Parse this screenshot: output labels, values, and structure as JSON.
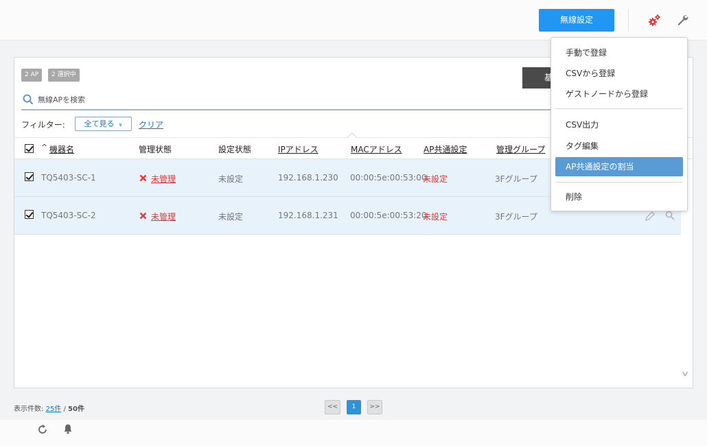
{
  "header": {
    "wireless_settings_button": "無線設定",
    "icons": [
      "gears-icon",
      "wrench-icon"
    ]
  },
  "panel": {
    "badge_ap": "2 AP",
    "badge_selected": "2 選択中",
    "dark_button_partial": "基",
    "search": {
      "placeholder": "無線APを検索",
      "value": ""
    },
    "filter": {
      "label": "フィルター:",
      "selected": "全て見る",
      "clear": "クリア"
    }
  },
  "table": {
    "sort_caret": "^",
    "columns": [
      "機器名",
      "管理状態",
      "設定状態",
      "IPアドレス",
      "MACアドレス",
      "AP共通設定",
      "管理グループ"
    ],
    "rows": [
      {
        "name": "TQ5403-SC-1",
        "status": "未管理",
        "config": "未設定",
        "ip": "192.168.1.230",
        "mac": "00:00:5e:00:53:00",
        "ap_common": "未設定",
        "group": "3Fグループ"
      },
      {
        "name": "TQ5403-SC-2",
        "status": "未管理",
        "config": "未設定",
        "ip": "192.168.1.231",
        "mac": "00:00:5e:00:53:20",
        "ap_common": "未設定",
        "group": "3Fグループ"
      }
    ]
  },
  "dropdown_menu": {
    "items": [
      "手動で登録",
      "CSVから登録",
      "ゲストノードから登録",
      "CSV出力",
      "タグ編集",
      "AP共通設定の割当",
      "削除"
    ],
    "active_index": 5
  },
  "footer": {
    "count_label": "表示件数:",
    "per_page": "25件",
    "total": "50件",
    "pager_prev": "<<",
    "pager_current": "1",
    "pager_next": ">>"
  },
  "colors": {
    "primary": "#2196f3",
    "danger": "#e53935",
    "row_selected": "#e8f2fb",
    "menu_active": "#5b9bd5",
    "link": "#1a78c2"
  }
}
